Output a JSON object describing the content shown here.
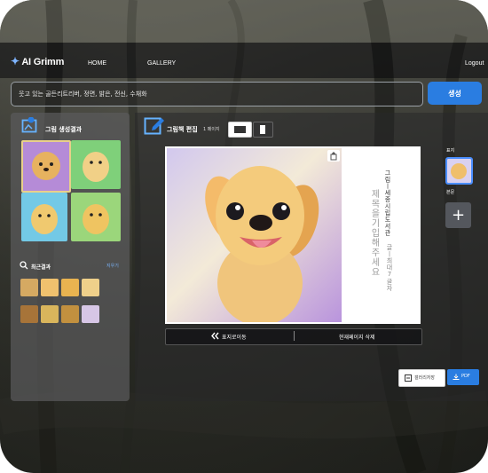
{
  "header": {
    "logo": "AI Grimm",
    "nav": [
      "HOME",
      "GALLERY"
    ],
    "logout": "Logout"
  },
  "search": {
    "value": "웃고 있는 골든리트리버, 정면, 밝은, 전신, 수채화",
    "button_label": "생성"
  },
  "left_panel": {
    "title": "그림 생성결과",
    "recent_title": "최근결과",
    "clear_label": "지우기"
  },
  "editor": {
    "title": "그림책 편집",
    "page_label": "1 페이지",
    "cover_text": "제목을기입해주세요",
    "author_text": "그림ㅣ세종시립도서관",
    "sub_text": "글ㅣ최대7글자",
    "move_to_cover": "표지로이동",
    "delete_page": "현재페이지 삭제"
  },
  "side": {
    "cover_label": "표지",
    "body_label": "본문",
    "add_label": "+"
  },
  "actions": {
    "gallery_save": "갤러리저장",
    "pdf": "PDF"
  },
  "colors": {
    "accent": "#2a7de1",
    "dog": "#e9b55a",
    "panel": "#5a5a5c"
  },
  "icons": [
    "image-icon",
    "edit-icon",
    "search-icon",
    "trash-icon",
    "chevron-left-icon",
    "gallery-save-icon",
    "download-icon"
  ]
}
